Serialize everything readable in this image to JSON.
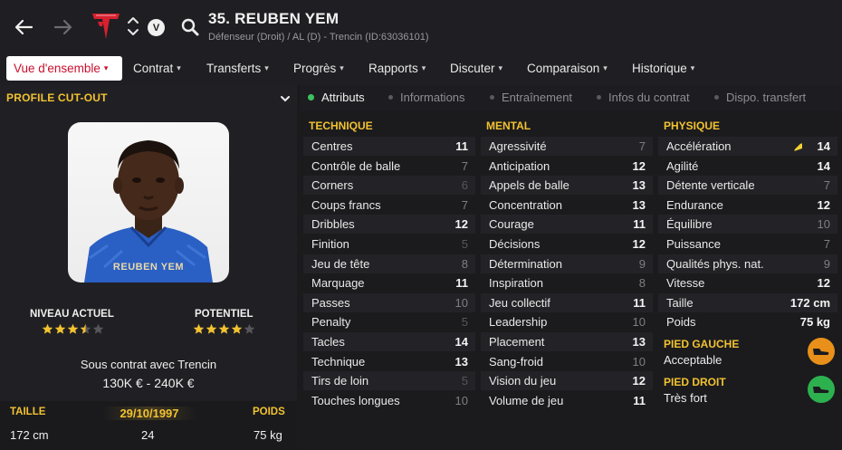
{
  "header": {
    "title": "35. REUBEN YEM",
    "subtitle": "Défenseur (Droit) / AL (D) - Trencin (ID:63036101)",
    "v_badge": "V"
  },
  "menu": [
    {
      "label": "Vue d'ensemble",
      "active": true
    },
    {
      "label": "Contrat"
    },
    {
      "label": "Transferts"
    },
    {
      "label": "Progrès"
    },
    {
      "label": "Rapports"
    },
    {
      "label": "Discuter"
    },
    {
      "label": "Comparaison"
    },
    {
      "label": "Historique"
    }
  ],
  "profile": {
    "heading": "PROFILE CUT-OUT",
    "jersey_name": "REUBEN YEM",
    "current_label": "NIVEAU ACTUEL",
    "current_stars": 3.5,
    "potential_label": "POTENTIEL",
    "potential_stars": 4,
    "contract_text": "Sous contrat avec Trencin",
    "value_range": "130K € - 240K €",
    "height_label": "TAILLE",
    "height": "172 cm",
    "birth_date": "29/10/1997",
    "age": "24",
    "weight_label": "POIDS",
    "weight": "75 kg"
  },
  "subtabs": [
    {
      "label": "Attributs",
      "active": true
    },
    {
      "label": "Informations"
    },
    {
      "label": "Entraînement"
    },
    {
      "label": "Infos du contrat"
    },
    {
      "label": "Dispo. transfert"
    }
  ],
  "attributes": {
    "technical": {
      "heading": "TECHNIQUE",
      "rows": [
        {
          "name": "Centres",
          "value": "11"
        },
        {
          "name": "Contrôle de balle",
          "value": "7"
        },
        {
          "name": "Corners",
          "value": "6"
        },
        {
          "name": "Coups francs",
          "value": "7"
        },
        {
          "name": "Dribbles",
          "value": "12"
        },
        {
          "name": "Finition",
          "value": "5"
        },
        {
          "name": "Jeu de tête",
          "value": "8"
        },
        {
          "name": "Marquage",
          "value": "11"
        },
        {
          "name": "Passes",
          "value": "10"
        },
        {
          "name": "Penalty",
          "value": "5"
        },
        {
          "name": "Tacles",
          "value": "14"
        },
        {
          "name": "Technique",
          "value": "13"
        },
        {
          "name": "Tirs de loin",
          "value": "5"
        },
        {
          "name": "Touches longues",
          "value": "10"
        }
      ]
    },
    "mental": {
      "heading": "MENTAL",
      "rows": [
        {
          "name": "Agressivité",
          "value": "7"
        },
        {
          "name": "Anticipation",
          "value": "12"
        },
        {
          "name": "Appels de balle",
          "value": "13"
        },
        {
          "name": "Concentration",
          "value": "13"
        },
        {
          "name": "Courage",
          "value": "11"
        },
        {
          "name": "Décisions",
          "value": "12"
        },
        {
          "name": "Détermination",
          "value": "9"
        },
        {
          "name": "Inspiration",
          "value": "8"
        },
        {
          "name": "Jeu collectif",
          "value": "11"
        },
        {
          "name": "Leadership",
          "value": "10"
        },
        {
          "name": "Placement",
          "value": "13"
        },
        {
          "name": "Sang-froid",
          "value": "10"
        },
        {
          "name": "Vision du jeu",
          "value": "12"
        },
        {
          "name": "Volume de jeu",
          "value": "11"
        }
      ]
    },
    "physical": {
      "heading": "PHYSIQUE",
      "rows": [
        {
          "name": "Accélération",
          "value": "14",
          "arrow": true
        },
        {
          "name": "Agilité",
          "value": "14"
        },
        {
          "name": "Détente verticale",
          "value": "7"
        },
        {
          "name": "Endurance",
          "value": "12"
        },
        {
          "name": "Équilibre",
          "value": "10"
        },
        {
          "name": "Puissance",
          "value": "7"
        },
        {
          "name": "Qualités phys. nat.",
          "value": "9"
        },
        {
          "name": "Vitesse",
          "value": "12"
        },
        {
          "name": "Taille",
          "value": "172 cm"
        },
        {
          "name": "Poids",
          "value": "75 kg"
        }
      ],
      "left_foot_label": "PIED GAUCHE",
      "left_foot_value": "Acceptable",
      "right_foot_label": "PIED DROIT",
      "right_foot_value": "Très fort"
    }
  },
  "colors": {
    "accent_yellow": "#f2c230",
    "active_red": "#c8102e",
    "active_dot": "#3ec15f",
    "left_foot_badge": "#e8901a",
    "right_foot_badge": "#2db14f"
  }
}
